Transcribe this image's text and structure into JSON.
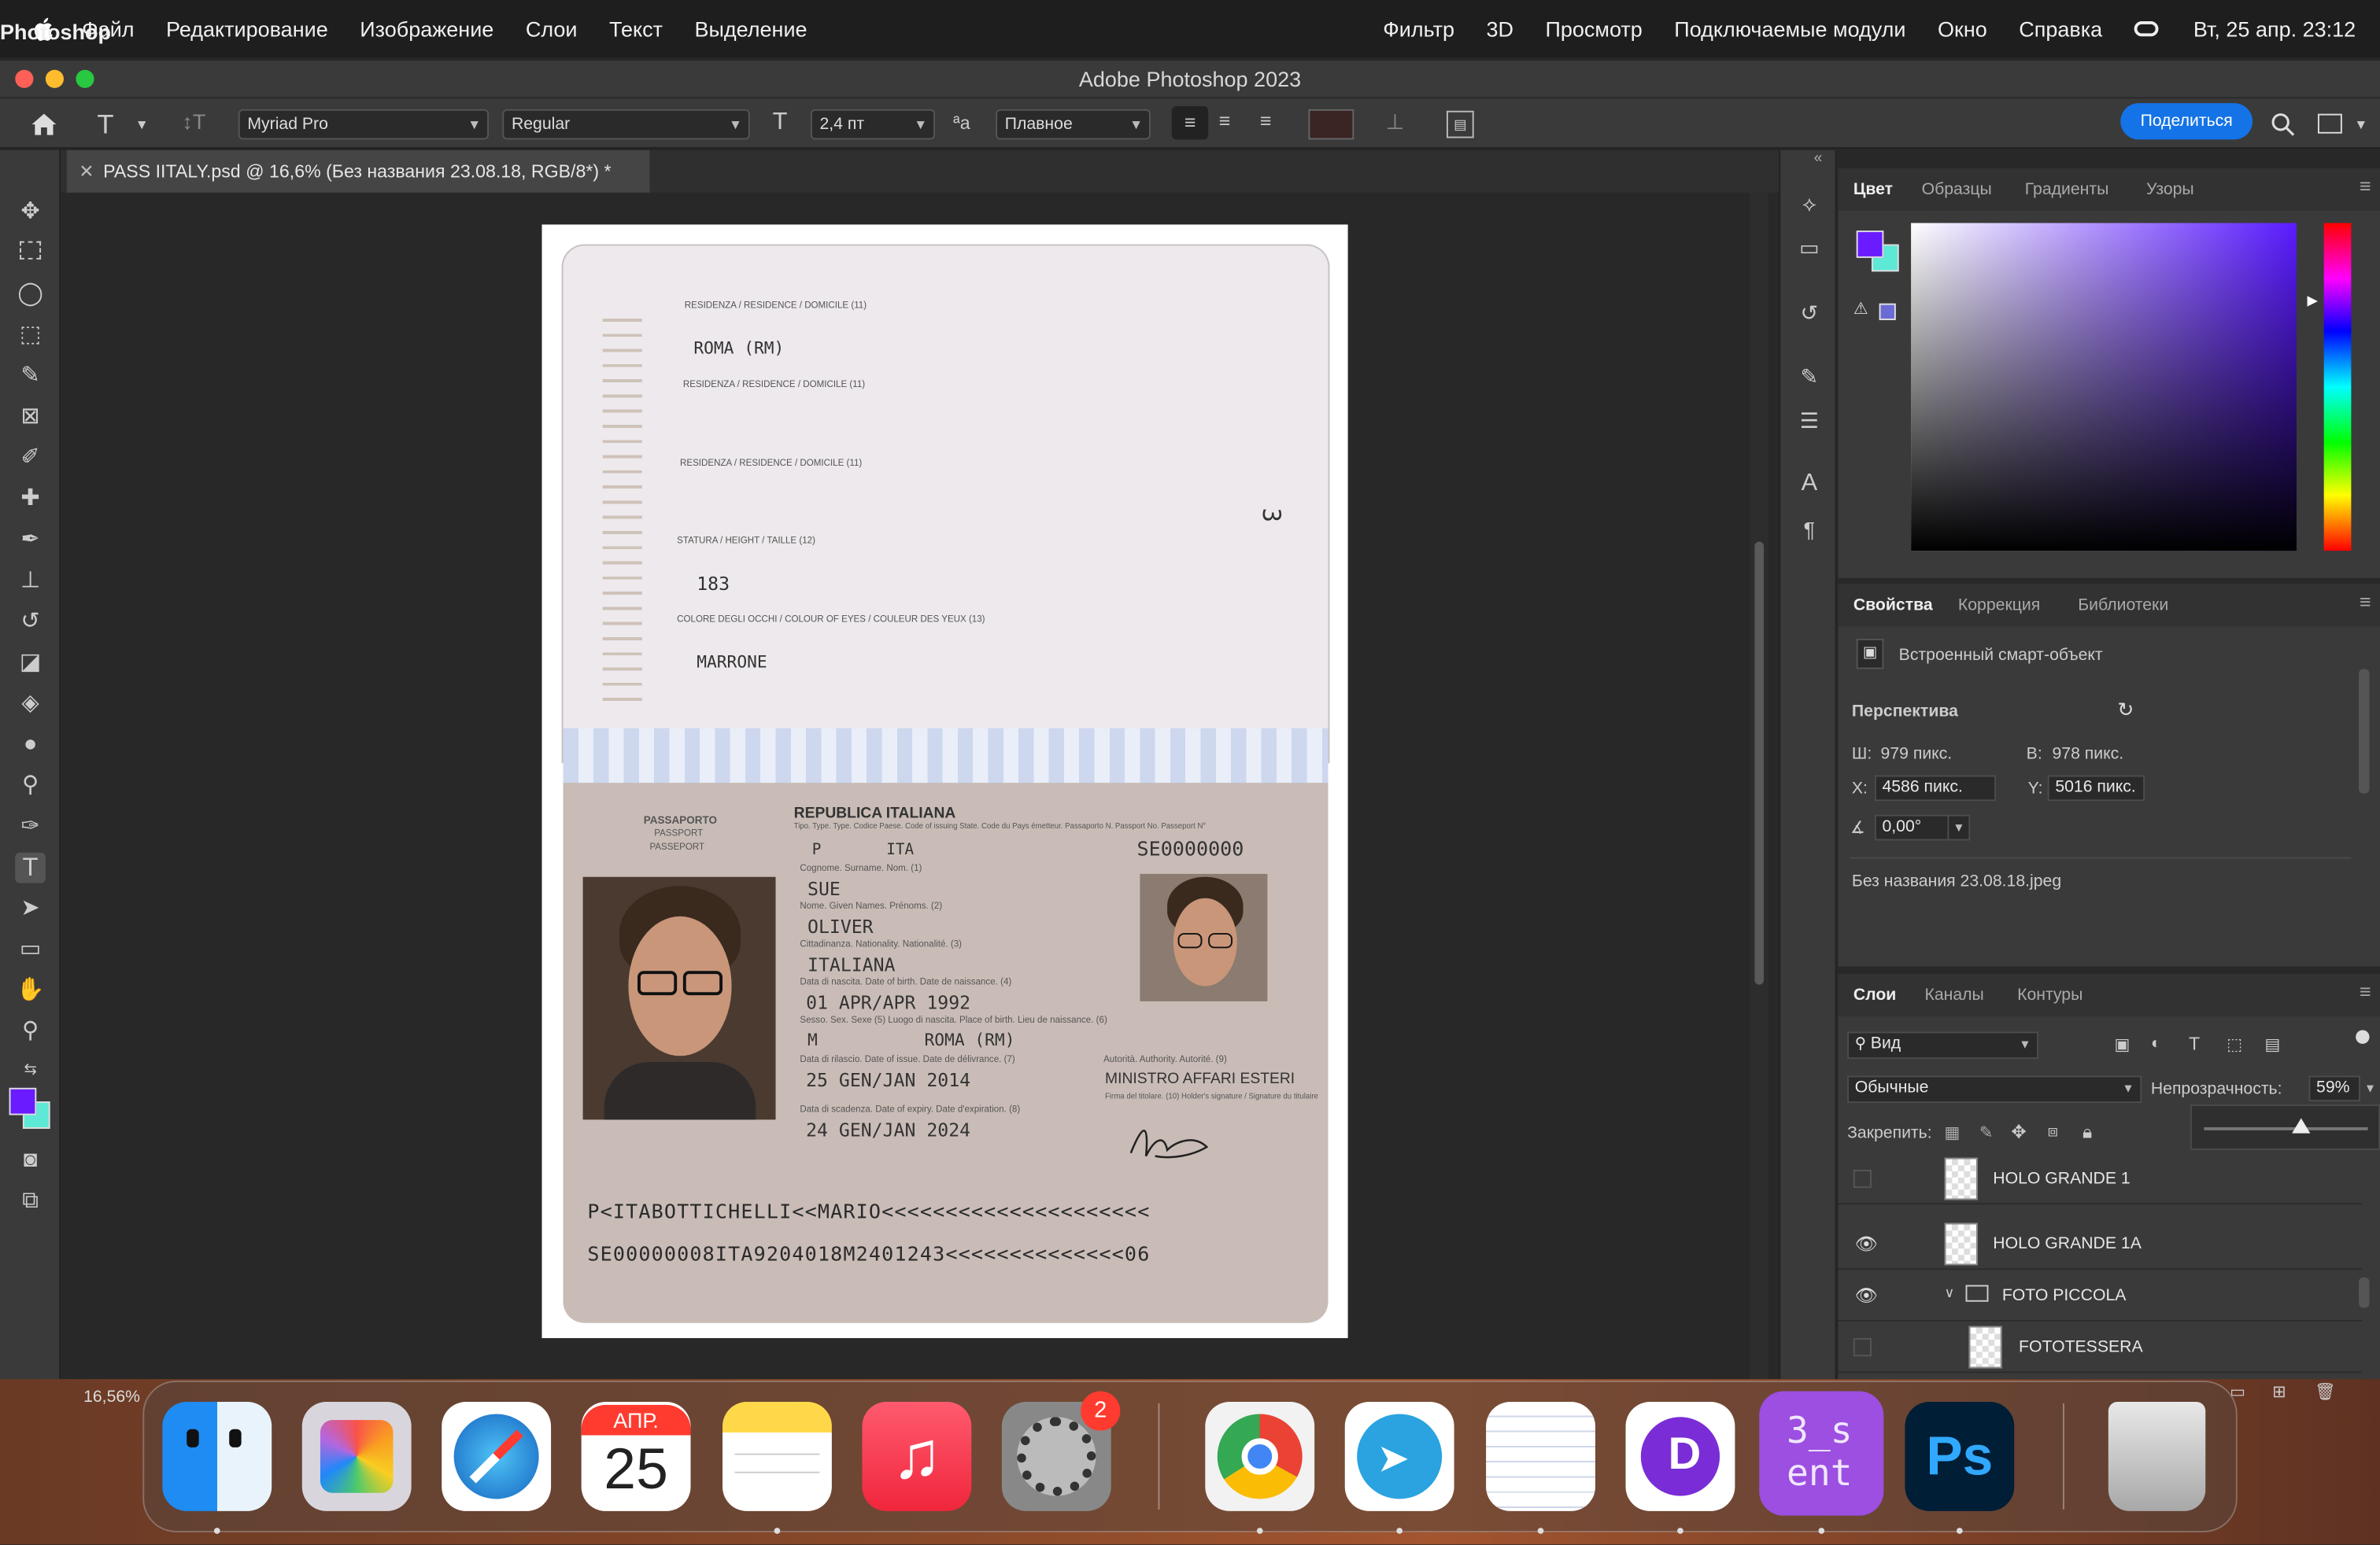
{
  "menubar": {
    "app": "Photoshop",
    "items": [
      "Файл",
      "Редактирование",
      "Изображение",
      "Слои",
      "Текст",
      "Выделение",
      "Фильтр",
      "3D",
      "Просмотр",
      "Подключаемые модули",
      "Окно",
      "Справка"
    ],
    "datetime": "Вт, 25 апр. 23:12"
  },
  "window": {
    "title": "Adobe Photoshop 2023"
  },
  "options": {
    "font_family": "Myriad Pro",
    "font_style": "Regular",
    "font_size": "2,4 пт",
    "antialias": "Плавное",
    "share": "Поделиться"
  },
  "doc_tab": {
    "title": "PASS IITALY.psd @ 16,6% (Без названия 23.08.18, RGB/8*) *"
  },
  "status": {
    "zoom": "16,56%"
  },
  "passport": {
    "res_label": "RESIDENZA / RESIDENCE / DOMICILE (11)",
    "res_value": "ROMA (RM)",
    "height_label": "STATURA / HEIGHT / TAILLE (12)",
    "height_value": "183",
    "eyes_label": "COLORE DEGLI OCCHI / COLOUR OF EYES / COULEUR DES YEUX (13)",
    "eyes_value": "MARRONE",
    "page_number": "3",
    "doc_type_it": "PASSAPORTO",
    "doc_type_en": "PASSPORT",
    "doc_type_fr": "PASSEPORT",
    "country": "REPUBLICA ITALIANA",
    "type_label": "Tipo. Type. Type. Codice Paese. Code of issuing State. Code du Pays émetteur. Passaporto N. Passport No. Passeport N°",
    "type_value": "P",
    "code_value": "ITA",
    "passport_no": "SE0000000",
    "surname_label": "Cognome. Surname. Nom. (1)",
    "surname": "SUE",
    "given_label": "Nome. Given Names. Prénoms. (2)",
    "given": "OLIVER",
    "nat_label": "Cittadinanza. Nationality. Nationalité. (3)",
    "nationality": "ITALIANA",
    "dob_label": "Data di nascita. Date of birth. Date de naissance. (4)",
    "dob": "01 APR/APR 1992",
    "sex_label": "Sesso. Sex. Sexe (5)   Luogo di nascita. Place of birth. Lieu de naissance. (6)",
    "sex": "M",
    "pob": "ROMA (RM)",
    "issue_label": "Data di rilascio. Date of issue. Date de délivrance. (7)",
    "issue": "25 GEN/JAN 2014",
    "authority_label": "Autorità. Authority. Autorité. (9)",
    "authority": "MINISTRO AFFARI ESTERI",
    "signature_label": "Firma del titolare. (10) Holder's signature / Signature du titulaire",
    "expiry_label": "Data di scadenza. Date of expiry. Date d'expiration. (8)",
    "expiry": "24 GEN/JAN 2024",
    "mrz1": "P<ITABOTTICHELLI<<MARIO<<<<<<<<<<<<<<<<<<<<<",
    "mrz2": "SE00000008ITA9204018M2401243<<<<<<<<<<<<<<06"
  },
  "color_panel": {
    "tabs": [
      "Цвет",
      "Образцы",
      "Градиенты",
      "Узоры"
    ],
    "fg": "#6a1bff",
    "bg": "#5ee8d6"
  },
  "props_panel": {
    "tabs": [
      "Свойства",
      "Коррекция",
      "Библиотеки"
    ],
    "type": "Встроенный смарт-объект",
    "section": "Перспектива",
    "w_label": "Ш:",
    "w": "979 пикс.",
    "h_label": "В:",
    "h": "978 пикс.",
    "x_label": "X:",
    "x": "4586 пикс.",
    "y_label": "Y:",
    "y": "5016 пикс.",
    "angle": "0,00°",
    "file": "Без названия 23.08.18.jpeg"
  },
  "layers_panel": {
    "tabs": [
      "Слои",
      "Каналы",
      "Контуры"
    ],
    "filter": "Вид",
    "blend": "Обычные",
    "opacity_label": "Непрозрачность:",
    "opacity": "59%",
    "lock_label": "Закрепить:",
    "opacity_fill": 0.59,
    "layers": [
      {
        "name": "HOLO GRANDE 1",
        "visible": false
      },
      {
        "name": "HOLO GRANDE 1A",
        "visible": true
      },
      {
        "name": "FOTO PICCOLA",
        "visible": true,
        "group": true
      },
      {
        "name": "FOTOTESSERA",
        "visible": false
      }
    ]
  },
  "dock": {
    "calendar_month": "АПР.",
    "calendar_day": "25",
    "settings_badge": "2",
    "app_label": "3_s\nent"
  }
}
